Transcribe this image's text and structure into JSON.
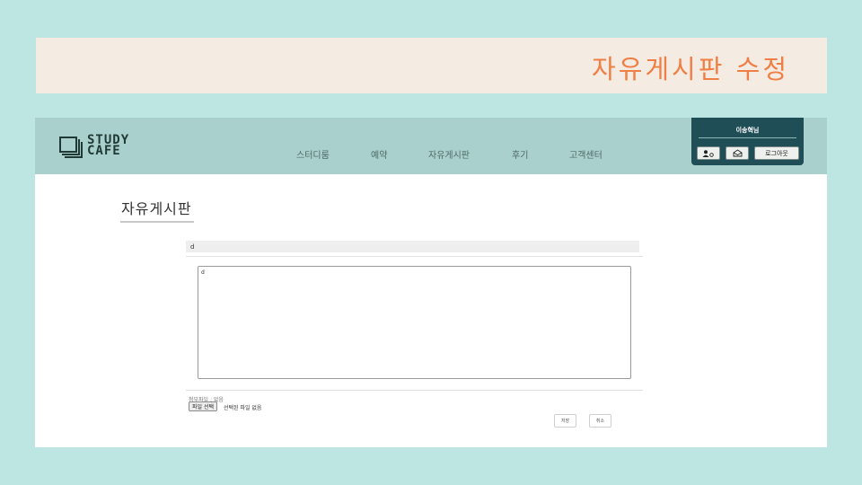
{
  "slide": {
    "title": "자유게시판 수정"
  },
  "header": {
    "logo_line1": "STUDY",
    "logo_line2": "CAFE",
    "nav": [
      "스터디룸",
      "예약",
      "자유게시판",
      "후기",
      "고객센터"
    ],
    "user": {
      "name": "이송혁님",
      "logout_label": "로그아웃",
      "mypage_icon": "user-icon",
      "message_icon": "envelope-icon"
    }
  },
  "board": {
    "heading": "자유게시판",
    "title_value": "d",
    "content_value": "d",
    "attachment_label": "첨부파일 : 없음",
    "file_button_label": "파일 선택",
    "file_status": "선택된 파일 없음",
    "save_label": "저장",
    "cancel_label": "취소"
  },
  "colors": {
    "background": "#bde6e2",
    "banner": "#f4ebe2",
    "title_accent": "#ef7f44",
    "header": "#a9d0cd",
    "user_box": "#1f4e56"
  }
}
